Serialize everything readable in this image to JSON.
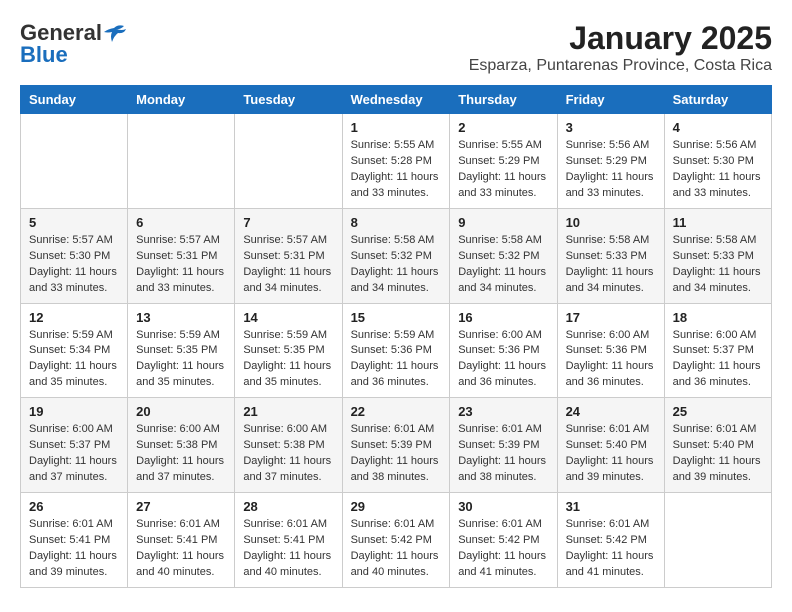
{
  "logo": {
    "general": "General",
    "blue": "Blue"
  },
  "title": "January 2025",
  "subtitle": "Esparza, Puntarenas Province, Costa Rica",
  "weekdays": [
    "Sunday",
    "Monday",
    "Tuesday",
    "Wednesday",
    "Thursday",
    "Friday",
    "Saturday"
  ],
  "weeks": [
    [
      null,
      null,
      null,
      {
        "day": 1,
        "sunrise": "5:55 AM",
        "sunset": "5:28 PM",
        "daylight": "11 hours and 33 minutes."
      },
      {
        "day": 2,
        "sunrise": "5:55 AM",
        "sunset": "5:29 PM",
        "daylight": "11 hours and 33 minutes."
      },
      {
        "day": 3,
        "sunrise": "5:56 AM",
        "sunset": "5:29 PM",
        "daylight": "11 hours and 33 minutes."
      },
      {
        "day": 4,
        "sunrise": "5:56 AM",
        "sunset": "5:30 PM",
        "daylight": "11 hours and 33 minutes."
      }
    ],
    [
      {
        "day": 5,
        "sunrise": "5:57 AM",
        "sunset": "5:30 PM",
        "daylight": "11 hours and 33 minutes."
      },
      {
        "day": 6,
        "sunrise": "5:57 AM",
        "sunset": "5:31 PM",
        "daylight": "11 hours and 33 minutes."
      },
      {
        "day": 7,
        "sunrise": "5:57 AM",
        "sunset": "5:31 PM",
        "daylight": "11 hours and 34 minutes."
      },
      {
        "day": 8,
        "sunrise": "5:58 AM",
        "sunset": "5:32 PM",
        "daylight": "11 hours and 34 minutes."
      },
      {
        "day": 9,
        "sunrise": "5:58 AM",
        "sunset": "5:32 PM",
        "daylight": "11 hours and 34 minutes."
      },
      {
        "day": 10,
        "sunrise": "5:58 AM",
        "sunset": "5:33 PM",
        "daylight": "11 hours and 34 minutes."
      },
      {
        "day": 11,
        "sunrise": "5:58 AM",
        "sunset": "5:33 PM",
        "daylight": "11 hours and 34 minutes."
      }
    ],
    [
      {
        "day": 12,
        "sunrise": "5:59 AM",
        "sunset": "5:34 PM",
        "daylight": "11 hours and 35 minutes."
      },
      {
        "day": 13,
        "sunrise": "5:59 AM",
        "sunset": "5:35 PM",
        "daylight": "11 hours and 35 minutes."
      },
      {
        "day": 14,
        "sunrise": "5:59 AM",
        "sunset": "5:35 PM",
        "daylight": "11 hours and 35 minutes."
      },
      {
        "day": 15,
        "sunrise": "5:59 AM",
        "sunset": "5:36 PM",
        "daylight": "11 hours and 36 minutes."
      },
      {
        "day": 16,
        "sunrise": "6:00 AM",
        "sunset": "5:36 PM",
        "daylight": "11 hours and 36 minutes."
      },
      {
        "day": 17,
        "sunrise": "6:00 AM",
        "sunset": "5:36 PM",
        "daylight": "11 hours and 36 minutes."
      },
      {
        "day": 18,
        "sunrise": "6:00 AM",
        "sunset": "5:37 PM",
        "daylight": "11 hours and 36 minutes."
      }
    ],
    [
      {
        "day": 19,
        "sunrise": "6:00 AM",
        "sunset": "5:37 PM",
        "daylight": "11 hours and 37 minutes."
      },
      {
        "day": 20,
        "sunrise": "6:00 AM",
        "sunset": "5:38 PM",
        "daylight": "11 hours and 37 minutes."
      },
      {
        "day": 21,
        "sunrise": "6:00 AM",
        "sunset": "5:38 PM",
        "daylight": "11 hours and 37 minutes."
      },
      {
        "day": 22,
        "sunrise": "6:01 AM",
        "sunset": "5:39 PM",
        "daylight": "11 hours and 38 minutes."
      },
      {
        "day": 23,
        "sunrise": "6:01 AM",
        "sunset": "5:39 PM",
        "daylight": "11 hours and 38 minutes."
      },
      {
        "day": 24,
        "sunrise": "6:01 AM",
        "sunset": "5:40 PM",
        "daylight": "11 hours and 39 minutes."
      },
      {
        "day": 25,
        "sunrise": "6:01 AM",
        "sunset": "5:40 PM",
        "daylight": "11 hours and 39 minutes."
      }
    ],
    [
      {
        "day": 26,
        "sunrise": "6:01 AM",
        "sunset": "5:41 PM",
        "daylight": "11 hours and 39 minutes."
      },
      {
        "day": 27,
        "sunrise": "6:01 AM",
        "sunset": "5:41 PM",
        "daylight": "11 hours and 40 minutes."
      },
      {
        "day": 28,
        "sunrise": "6:01 AM",
        "sunset": "5:41 PM",
        "daylight": "11 hours and 40 minutes."
      },
      {
        "day": 29,
        "sunrise": "6:01 AM",
        "sunset": "5:42 PM",
        "daylight": "11 hours and 40 minutes."
      },
      {
        "day": 30,
        "sunrise": "6:01 AM",
        "sunset": "5:42 PM",
        "daylight": "11 hours and 41 minutes."
      },
      {
        "day": 31,
        "sunrise": "6:01 AM",
        "sunset": "5:42 PM",
        "daylight": "11 hours and 41 minutes."
      },
      null
    ]
  ],
  "labels": {
    "sunrise": "Sunrise:",
    "sunset": "Sunset:",
    "daylight": "Daylight:"
  }
}
